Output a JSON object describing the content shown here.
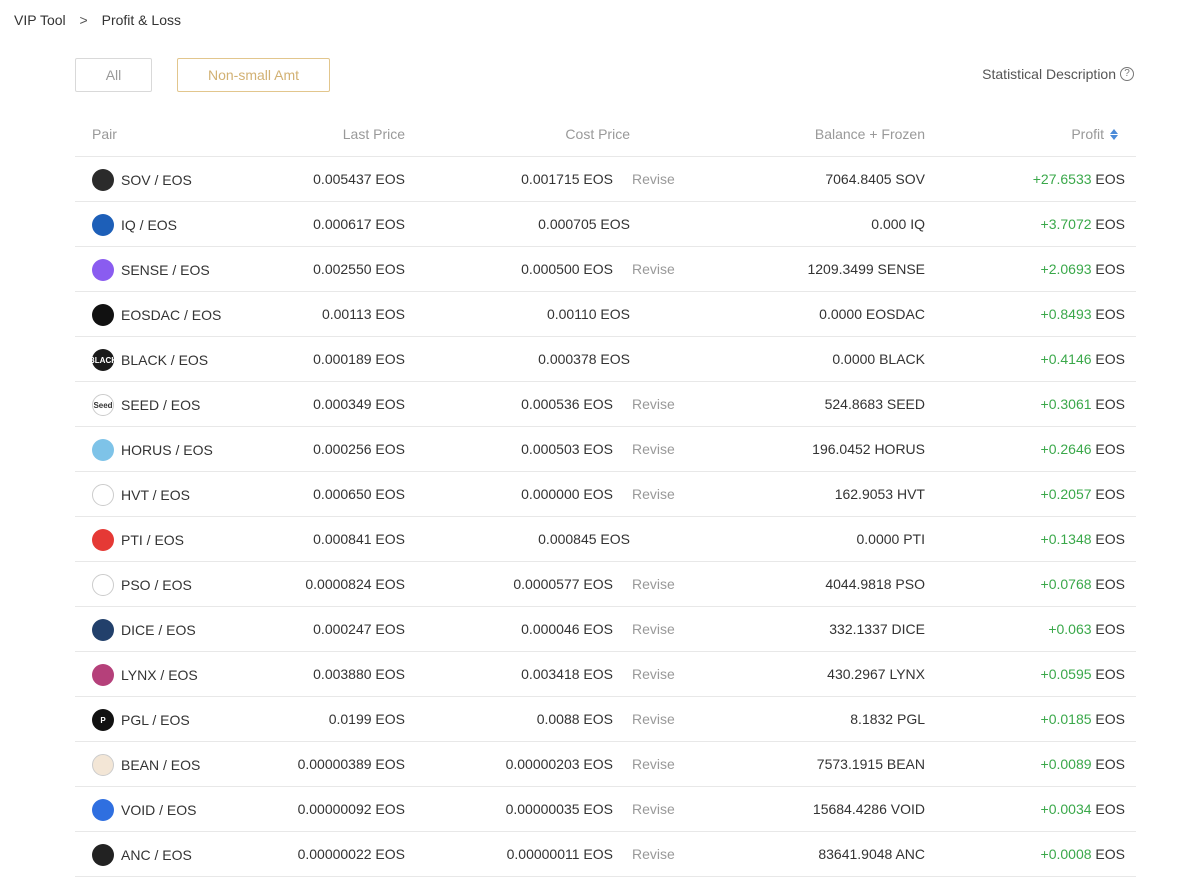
{
  "breadcrumb": {
    "root": "VIP Tool",
    "separator": ">",
    "current": "Profit & Loss"
  },
  "filters": {
    "all_label": "All",
    "nonsmall_label": "Non-small Amt",
    "active": "Non-small Amt"
  },
  "stat_desc": {
    "label": "Statistical Description",
    "icon": "?"
  },
  "table": {
    "headers": {
      "pair": "Pair",
      "last_price": "Last Price",
      "cost_price": "Cost Price",
      "balance": "Balance + Frozen",
      "profit": "Profit"
    },
    "revise_label": "Revise",
    "rows": [
      {
        "icon": "sov-icon",
        "icon_text": "",
        "icon_color": "#2b2b2b",
        "pair": "SOV / EOS",
        "last_price": "0.005437 EOS",
        "cost_price": "0.001715 EOS",
        "revise": true,
        "balance": "7064.8405 SOV",
        "profit": "+27.6533",
        "unit": "EOS"
      },
      {
        "icon": "iq-icon",
        "icon_text": "",
        "icon_color": "#1d5fb8",
        "pair": "IQ / EOS",
        "last_price": "0.000617 EOS",
        "cost_price": "0.000705 EOS",
        "revise": false,
        "balance": "0.000 IQ",
        "profit": "+3.7072",
        "unit": "EOS"
      },
      {
        "icon": "sense-icon",
        "icon_text": "",
        "icon_color": "#8a5cf0",
        "pair": "SENSE / EOS",
        "last_price": "0.002550 EOS",
        "cost_price": "0.000500 EOS",
        "revise": true,
        "balance": "1209.3499 SENSE",
        "profit": "+2.0693",
        "unit": "EOS"
      },
      {
        "icon": "eosdac-icon",
        "icon_text": "",
        "icon_color": "#111111",
        "pair": "EOSDAC / EOS",
        "last_price": "0.00113 EOS",
        "cost_price": "0.00110 EOS",
        "revise": false,
        "balance": "0.0000 EOSDAC",
        "profit": "+0.8493",
        "unit": "EOS"
      },
      {
        "icon": "black-icon",
        "icon_text": "BLACK",
        "icon_color": "#1a1a1a",
        "pair": "BLACK / EOS",
        "last_price": "0.000189 EOS",
        "cost_price": "0.000378 EOS",
        "revise": false,
        "balance": "0.0000 BLACK",
        "profit": "+0.4146",
        "unit": "EOS"
      },
      {
        "icon": "seed-icon",
        "icon_text": "Seed",
        "icon_color": "#ffffff",
        "pair": "SEED / EOS",
        "last_price": "0.000349 EOS",
        "cost_price": "0.000536 EOS",
        "revise": true,
        "balance": "524.8683 SEED",
        "profit": "+0.3061",
        "unit": "EOS"
      },
      {
        "icon": "horus-icon",
        "icon_text": "",
        "icon_color": "#7ec3e8",
        "pair": "HORUS / EOS",
        "last_price": "0.000256 EOS",
        "cost_price": "0.000503 EOS",
        "revise": true,
        "balance": "196.0452 HORUS",
        "profit": "+0.2646",
        "unit": "EOS"
      },
      {
        "icon": "hvt-icon",
        "icon_text": "",
        "icon_color": "#ffffff",
        "pair": "HVT / EOS",
        "last_price": "0.000650 EOS",
        "cost_price": "0.000000 EOS",
        "revise": true,
        "balance": "162.9053 HVT",
        "profit": "+0.2057",
        "unit": "EOS"
      },
      {
        "icon": "pti-icon",
        "icon_text": "",
        "icon_color": "#e53935",
        "pair": "PTI / EOS",
        "last_price": "0.000841 EOS",
        "cost_price": "0.000845 EOS",
        "revise": false,
        "balance": "0.0000 PTI",
        "profit": "+0.1348",
        "unit": "EOS"
      },
      {
        "icon": "pso-icon",
        "icon_text": "",
        "icon_color": "#ffffff",
        "pair": "PSO / EOS",
        "last_price": "0.0000824 EOS",
        "cost_price": "0.0000577 EOS",
        "revise": true,
        "balance": "4044.9818 PSO",
        "profit": "+0.0768",
        "unit": "EOS"
      },
      {
        "icon": "dice-icon",
        "icon_text": "",
        "icon_color": "#22406b",
        "pair": "DICE / EOS",
        "last_price": "0.000247 EOS",
        "cost_price": "0.000046 EOS",
        "revise": true,
        "balance": "332.1337 DICE",
        "profit": "+0.063",
        "unit": "EOS"
      },
      {
        "icon": "lynx-icon",
        "icon_text": "",
        "icon_color": "#b5407a",
        "pair": "LYNX / EOS",
        "last_price": "0.003880 EOS",
        "cost_price": "0.003418 EOS",
        "revise": true,
        "balance": "430.2967 LYNX",
        "profit": "+0.0595",
        "unit": "EOS"
      },
      {
        "icon": "pgl-icon",
        "icon_text": "P",
        "icon_color": "#111111",
        "pair": "PGL / EOS",
        "last_price": "0.0199 EOS",
        "cost_price": "0.0088 EOS",
        "revise": true,
        "balance": "8.1832 PGL",
        "profit": "+0.0185",
        "unit": "EOS"
      },
      {
        "icon": "bean-icon",
        "icon_text": "",
        "icon_color": "#f3e6d6",
        "pair": "BEAN / EOS",
        "last_price": "0.00000389 EOS",
        "cost_price": "0.00000203 EOS",
        "revise": true,
        "balance": "7573.1915 BEAN",
        "profit": "+0.0089",
        "unit": "EOS"
      },
      {
        "icon": "void-icon",
        "icon_text": "",
        "icon_color": "#2f6fe0",
        "pair": "VOID / EOS",
        "last_price": "0.00000092 EOS",
        "cost_price": "0.00000035 EOS",
        "revise": true,
        "balance": "15684.4286 VOID",
        "profit": "+0.0034",
        "unit": "EOS"
      },
      {
        "icon": "anc-icon",
        "icon_text": "",
        "icon_color": "#222222",
        "pair": "ANC / EOS",
        "last_price": "0.00000022 EOS",
        "cost_price": "0.00000011 EOS",
        "revise": true,
        "balance": "83641.9048 ANC",
        "profit": "+0.0008",
        "unit": "EOS"
      }
    ]
  },
  "colors": {
    "profit_positive": "#3aa84a",
    "accent_gold": "#d2b173",
    "sort_blue": "#4c8bd8"
  }
}
